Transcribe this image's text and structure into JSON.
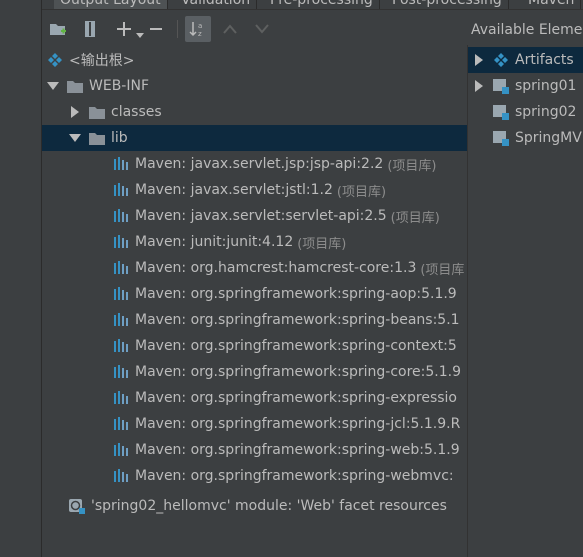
{
  "tabs": [
    "Output Layout",
    "Validation",
    "Pre-processing",
    "Post-processing",
    "Maven"
  ],
  "available_title": "Available Eleme",
  "tree": {
    "root": "<输出根>",
    "webinf": "WEB-INF",
    "classes": "classes",
    "lib": "lib",
    "libraries": [
      {
        "name": "Maven: javax.servlet.jsp:jsp-api:2.2",
        "scope": "(项目库)"
      },
      {
        "name": "Maven: javax.servlet:jstl:1.2",
        "scope": "(项目库)"
      },
      {
        "name": "Maven: javax.servlet:servlet-api:2.5",
        "scope": "(项目库)"
      },
      {
        "name": "Maven: junit:junit:4.12",
        "scope": "(项目库)"
      },
      {
        "name": "Maven: org.hamcrest:hamcrest-core:1.3",
        "scope": "(项目库"
      },
      {
        "name": "Maven: org.springframework:spring-aop:5.1.9",
        "scope": ""
      },
      {
        "name": "Maven: org.springframework:spring-beans:5.1",
        "scope": ""
      },
      {
        "name": "Maven: org.springframework:spring-context:5",
        "scope": ""
      },
      {
        "name": "Maven: org.springframework:spring-core:5.1.9",
        "scope": ""
      },
      {
        "name": "Maven: org.springframework:spring-expressio",
        "scope": ""
      },
      {
        "name": "Maven: org.springframework:spring-jcl:5.1.9.R",
        "scope": ""
      },
      {
        "name": "Maven: org.springframework:spring-web:5.1.9",
        "scope": ""
      },
      {
        "name": "Maven: org.springframework:spring-webmvc:",
        "scope": ""
      }
    ],
    "facet": "'spring02_hellomvc' module: 'Web' facet resources"
  },
  "available": [
    "Artifacts",
    "spring01",
    "spring02",
    "SpringMV"
  ],
  "colors": {
    "selection": "#0d293e",
    "accent": "#3592c4",
    "background": "#3c3f41"
  }
}
